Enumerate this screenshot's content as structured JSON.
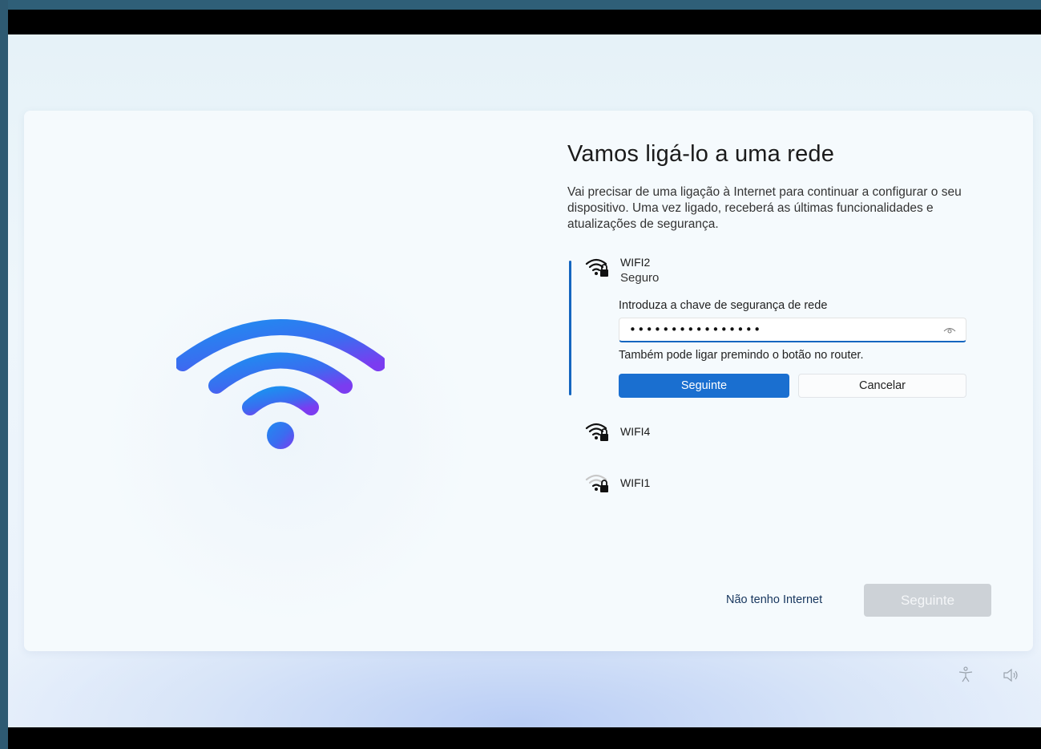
{
  "setup": {
    "title": "Vamos ligá-lo a uma rede",
    "description": "Vai precisar de uma ligação à Internet para continuar a configurar o seu dispositivo. Uma vez ligado, receberá as últimas funcionalidades e atualizações de segurança.",
    "hero_icon": "wifi-icon",
    "accent_color": "#1a6fd0"
  },
  "networks": {
    "selected": {
      "name": "WIFI2",
      "status": "Seguro",
      "key_label": "Introduza a chave de segurança de rede",
      "key_value": "••••••••••••••••",
      "router_hint": "Também pode ligar premindo o botão no router.",
      "next_label": "Seguinte",
      "cancel_label": "Cancelar"
    },
    "others": [
      {
        "name": "WIFI4",
        "icon": "wifi-secured-icon"
      },
      {
        "name": "WIFI1",
        "icon": "wifi-secured-weak-icon"
      }
    ]
  },
  "footer": {
    "no_internet_label": "Não tenho Internet",
    "next_label": "Seguinte"
  },
  "system_tray": {
    "accessibility_icon": "accessibility-icon",
    "volume_icon": "volume-icon"
  }
}
